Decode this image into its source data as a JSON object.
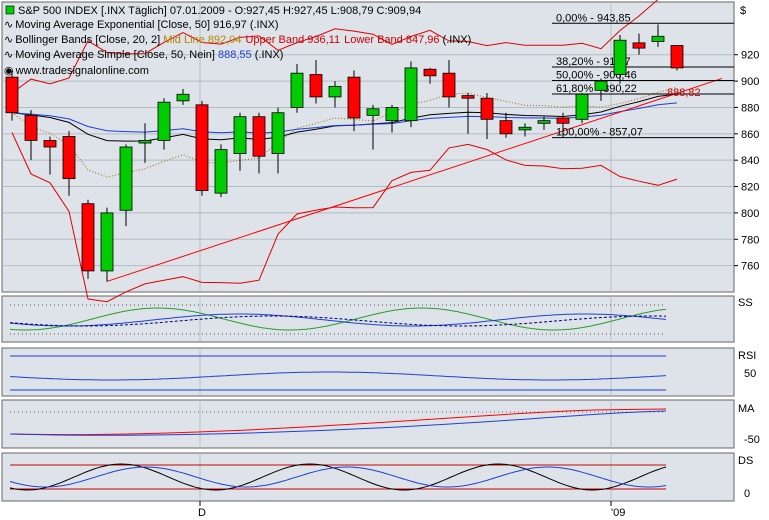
{
  "legend": {
    "title": "S&P 500 INDEX [.INX  Täglich] 07.01.2009 - O:927,45 H:927,45 L:908,79 C:909,94",
    "ema": "Moving Average Exponential [Close, 50] 916,97 (.INX)",
    "bb_prefix": "Bollinger Bands [Close, 20, 2] ",
    "bb_mid": "Mid Line 892,04",
    "bb_upper": "Upper Band 936,11",
    "bb_lower": "Lower Band 847,96",
    "bb_suffix": " (.INX)",
    "sma_prefix": "Moving Average Simple [Close, 50, Nein] ",
    "sma_value": "888,55",
    "sma_suffix": " (.INX)",
    "watermark": "www.tradesignalonline.com",
    "symbol_right": "$"
  },
  "colors": {
    "up": "#00cc00",
    "down": "#ff0000",
    "ema": "#000000",
    "bb": "#e00000",
    "sma": "#1f3fd6",
    "trendline": "#ff0000",
    "panel_bg": "#dde3e9",
    "label_red": "#cc0000"
  },
  "price_label": "888,82",
  "fib_labels": [
    "0,00% - 943,85",
    "38,20% - 910,7",
    "50,00% - 900,46",
    "61,80% - 890,22",
    "100,00% - 857,07"
  ],
  "x_labels": [
    "D",
    "'09"
  ],
  "panels": [
    "SS",
    "RSI",
    "MA",
    "DS"
  ],
  "chart_data": {
    "type": "candlestick",
    "title": "S&P 500 INDEX [.INX  Täglich]",
    "ylim": [
      740,
      960
    ],
    "y_ticks": [
      760,
      780,
      800,
      820,
      840,
      860,
      880,
      900,
      920
    ],
    "ohlc": [
      [
        903,
        908,
        870,
        876
      ],
      [
        874,
        878,
        840,
        855
      ],
      [
        855,
        858,
        829,
        850
      ],
      [
        858,
        862,
        813,
        826
      ],
      [
        807,
        810,
        750,
        756
      ],
      [
        756,
        804,
        748,
        800
      ],
      [
        802,
        852,
        790,
        850
      ],
      [
        853,
        868,
        838,
        855
      ],
      [
        855,
        887,
        848,
        884
      ],
      [
        885,
        894,
        882,
        890
      ],
      [
        882,
        885,
        813,
        817
      ],
      [
        815,
        852,
        812,
        848
      ],
      [
        845,
        876,
        832,
        873
      ],
      [
        873,
        876,
        830,
        843
      ],
      [
        845,
        880,
        830,
        876
      ],
      [
        880,
        913,
        876,
        906
      ],
      [
        905,
        916,
        883,
        888
      ],
      [
        888,
        900,
        880,
        896
      ],
      [
        903,
        908,
        862,
        872
      ],
      [
        874,
        882,
        848,
        879
      ],
      [
        870,
        882,
        861,
        880
      ],
      [
        870,
        915,
        865,
        910
      ],
      [
        909,
        910,
        898,
        904
      ],
      [
        906,
        916,
        880,
        888
      ],
      [
        889,
        891,
        860,
        887
      ],
      [
        887,
        891,
        856,
        871
      ],
      [
        870,
        876,
        857,
        860
      ],
      [
        863,
        868,
        858,
        865
      ],
      [
        868,
        873,
        863,
        870
      ],
      [
        872,
        876,
        857,
        868
      ],
      [
        871,
        891,
        868,
        890
      ],
      [
        893,
        902,
        885,
        900
      ],
      [
        905,
        935,
        898,
        931
      ],
      [
        929,
        936,
        920,
        925
      ],
      [
        930,
        943,
        926,
        934
      ],
      [
        927,
        927,
        908,
        910
      ]
    ],
    "fibonacci": [
      {
        "label": "0,00%",
        "value": 943.85
      },
      {
        "label": "38,20%",
        "value": 910.7
      },
      {
        "label": "50,00%",
        "value": 900.46
      },
      {
        "label": "61,80%",
        "value": 890.22
      },
      {
        "label": "100,00%",
        "value": 857.07
      }
    ],
    "x_axis_labels": [
      "D",
      "'09"
    ],
    "last_price": 888.82,
    "indicators": [
      "Moving Average Exponential [Close, 50]",
      "Bollinger Bands [Close, 20, 2]",
      "Moving Average Simple [Close, 50, Nein]"
    ],
    "sub_panels": [
      {
        "name": "SS",
        "type": "line"
      },
      {
        "name": "RSI",
        "type": "line",
        "ticks": [
          50
        ]
      },
      {
        "name": "MA",
        "type": "line",
        "ticks": [
          -50
        ]
      },
      {
        "name": "DS",
        "type": "line",
        "ticks": [
          0
        ]
      }
    ]
  }
}
